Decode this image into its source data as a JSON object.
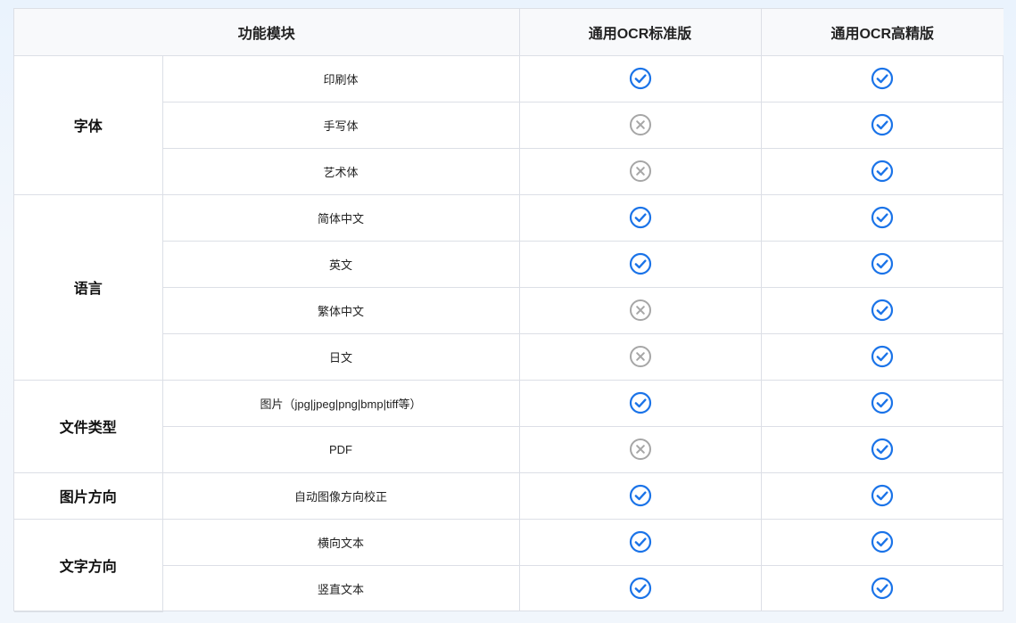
{
  "header": {
    "col_feature": "功能模块",
    "col_standard": "通用OCR标准版",
    "col_premium": "通用OCR高精版"
  },
  "colors": {
    "supported": "#1a73e8",
    "unsupported": "#a6a6a6"
  },
  "groups": [
    {
      "category": "字体",
      "rows": [
        {
          "feature": "印刷体",
          "standard": "supported",
          "premium": "supported"
        },
        {
          "feature": "手写体",
          "standard": "unsupported",
          "premium": "supported"
        },
        {
          "feature": "艺术体",
          "standard": "unsupported",
          "premium": "supported"
        }
      ]
    },
    {
      "category": "语言",
      "rows": [
        {
          "feature": "简体中文",
          "standard": "supported",
          "premium": "supported"
        },
        {
          "feature": "英文",
          "standard": "supported",
          "premium": "supported"
        },
        {
          "feature": "繁体中文",
          "standard": "unsupported",
          "premium": "supported"
        },
        {
          "feature": "日文",
          "standard": "unsupported",
          "premium": "supported"
        }
      ]
    },
    {
      "category": "文件类型",
      "rows": [
        {
          "feature": "图片（jpg|jpeg|png|bmp|tiff等）",
          "standard": "supported",
          "premium": "supported"
        },
        {
          "feature": "PDF",
          "standard": "unsupported",
          "premium": "supported"
        }
      ]
    },
    {
      "category": "图片方向",
      "rows": [
        {
          "feature": "自动图像方向校正",
          "standard": "supported",
          "premium": "supported"
        }
      ]
    },
    {
      "category": "文字方向",
      "rows": [
        {
          "feature": "横向文本",
          "standard": "supported",
          "premium": "supported"
        },
        {
          "feature": "竖直文本",
          "standard": "supported",
          "premium": "supported"
        }
      ]
    }
  ]
}
